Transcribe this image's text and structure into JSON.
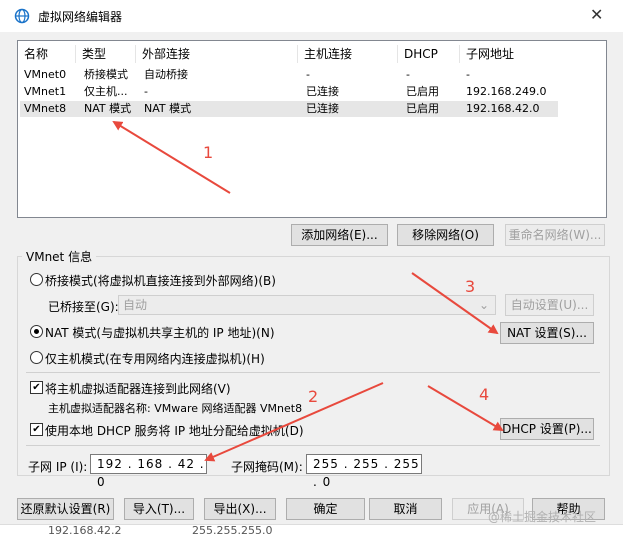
{
  "window": {
    "title": "虚拟网络编辑器",
    "close_glyph": "✕"
  },
  "network_list": {
    "columns": [
      "名称",
      "类型",
      "外部连接",
      "主机连接",
      "DHCP",
      "子网地址"
    ],
    "rows": [
      {
        "name": "VMnet0",
        "type": "桥接模式",
        "external": "自动桥接",
        "host": "-",
        "dhcp": "-",
        "subnet": "-"
      },
      {
        "name": "VMnet1",
        "type": "仅主机...",
        "external": "-",
        "host": "已连接",
        "dhcp": "已启用",
        "subnet": "192.168.249.0"
      },
      {
        "name": "VMnet8",
        "type": "NAT 模式",
        "external": "NAT 模式",
        "host": "已连接",
        "dhcp": "已启用",
        "subnet": "192.168.42.0"
      }
    ],
    "selected_index": 2
  },
  "list_buttons": {
    "add": "添加网络(E)...",
    "remove": "移除网络(O)",
    "rename": "重命名网络(W)..."
  },
  "vmnet_info": {
    "label": "VMnet 信息",
    "bridged_radio": "桥接模式(将虚拟机直接连接到外部网络)(B)",
    "bridged_to_label": "已桥接至(G):",
    "bridged_to_value": "自动",
    "auto_settings": "自动设置(U)...",
    "nat_radio": "NAT 模式(与虚拟机共享主机的 IP 地址)(N)",
    "nat_settings": "NAT 设置(S)...",
    "hostonly_radio": "仅主机模式(在专用网络内连接虚拟机)(H)",
    "connect_adapter": "将主机虚拟适配器连接到此网络(V)",
    "adapter_name": "主机虚拟适配器名称: VMware 网络适配器 VMnet8",
    "use_dhcp": "使用本地 DHCP 服务将 IP 地址分配给虚拟机(D)",
    "dhcp_settings": "DHCP 设置(P)...",
    "subnet_ip_label": "子网 IP (I):",
    "subnet_ip": "192 . 168 . 42 . 0",
    "subnet_mask_label": "子网掩码(M):",
    "subnet_mask": "255 . 255 . 255 . 0",
    "selected_mode": "nat",
    "connect_adapter_checked": true,
    "use_dhcp_checked": true
  },
  "footer_buttons": {
    "restore": "还原默认设置(R)",
    "import": "导入(T)...",
    "export": "导出(X)...",
    "ok": "确定",
    "cancel": "取消",
    "apply": "应用(A)",
    "help": "帮助"
  },
  "background_strip": {
    "ip": "192.168.42.2",
    "mask": "255.255.255.0"
  },
  "watermark": "@稀土掘金技术社区",
  "annotations": [
    "1",
    "2",
    "3",
    "4"
  ],
  "colors": {
    "arrow": "#e8493d",
    "selected_row": "#e6e6e6",
    "icon_blue": "#1a73c9"
  }
}
